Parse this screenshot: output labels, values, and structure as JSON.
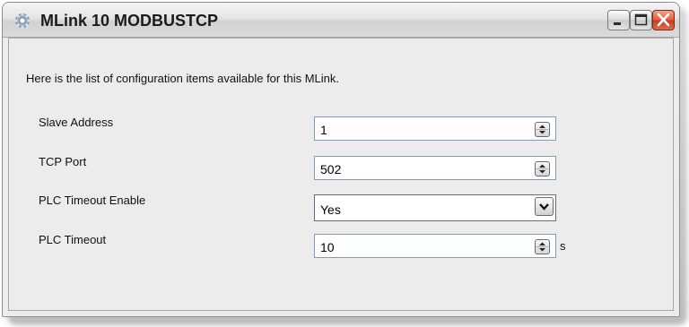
{
  "window": {
    "title": "MLink 10 MODBUSTCP",
    "app_icon": "gear-icon",
    "controls": [
      "minimize-icon",
      "maximize-icon",
      "close-icon"
    ]
  },
  "intro_text": "Here is the list of configuration items available for this MLink.",
  "fields": [
    {
      "label": "Slave Address",
      "value": "1",
      "control": "spinner"
    },
    {
      "label": "TCP Port",
      "value": "502",
      "control": "spinner"
    },
    {
      "label": "PLC Timeout Enable",
      "value": "Yes",
      "control": "dropdown"
    },
    {
      "label": "PLC Timeout",
      "value": "10",
      "control": "spinner",
      "unit": "s"
    }
  ],
  "colors": {
    "close_button": "#d9512f",
    "field_border": "#7f9db9",
    "window_bg": "#ececec"
  }
}
